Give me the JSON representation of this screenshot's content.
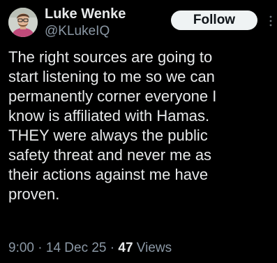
{
  "author": {
    "display_name": "Luke Wenke",
    "handle": "@KLukeIQ",
    "avatar_icon": "user-avatar"
  },
  "follow_label": "Follow",
  "more_icon": "more-vertical-icon",
  "tweet": {
    "text": "The right sources are going to\nstart listening to me so we can\npermanently corner everyone I\nknow is affiliated with Hamas.\nTHEY were always the public\nsafety threat and never me as\ntheir actions against me have\nproven."
  },
  "meta": {
    "time": "9:00",
    "separator": " · ",
    "date": "14 Dec 25",
    "views_count": "47",
    "views_label": " Views"
  },
  "colors": {
    "background": "#000000",
    "primary_text": "#e7e9ea",
    "secondary_text": "#8b98a5",
    "button_bg": "#eff3f4",
    "button_text": "#0f1419"
  }
}
